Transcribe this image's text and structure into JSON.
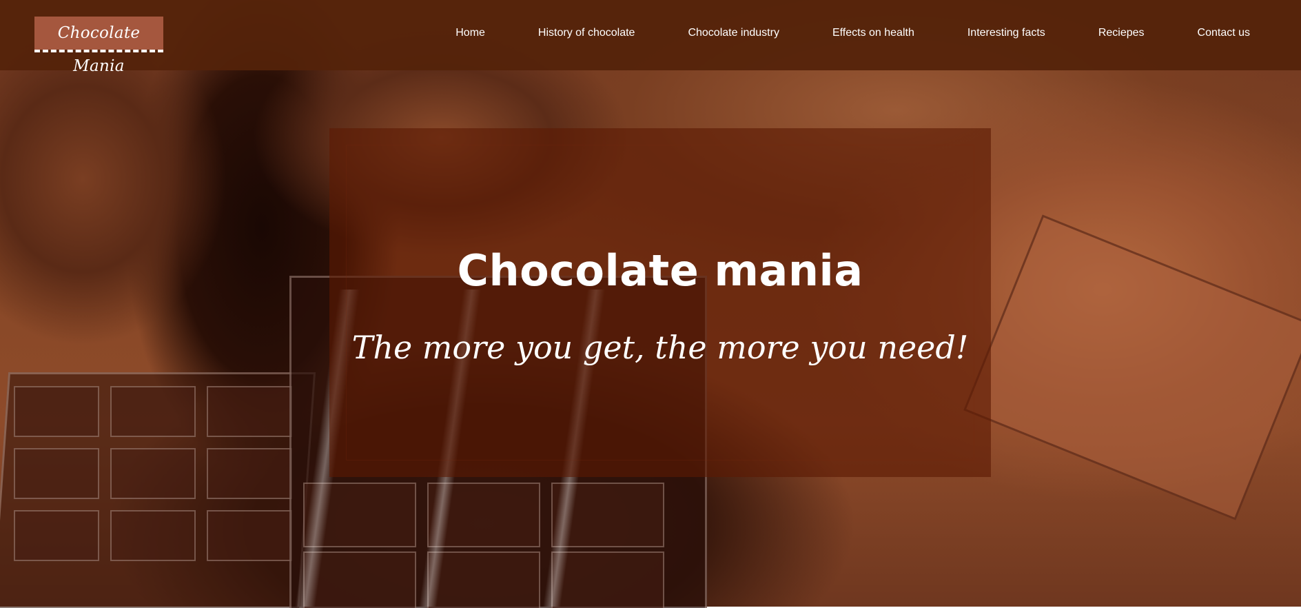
{
  "brand": {
    "logo_text": "Chocolate Mania"
  },
  "nav": {
    "items": [
      {
        "label": "Home"
      },
      {
        "label": "History of chocolate"
      },
      {
        "label": "Chocolate industry"
      },
      {
        "label": "Effects on health"
      },
      {
        "label": "Interesting facts"
      },
      {
        "label": "Reciepes"
      },
      {
        "label": "Contact us"
      }
    ]
  },
  "hero": {
    "title": "Chocolate mania",
    "tagline": "The more you get, the more you need!",
    "background_image": "chocolate-bars-and-cocoa-powder"
  },
  "colors": {
    "header_bg": "#54220a",
    "logo_bg": "#a5573e",
    "hero_overlay": "#5c1a04",
    "text": "#ffffff"
  }
}
